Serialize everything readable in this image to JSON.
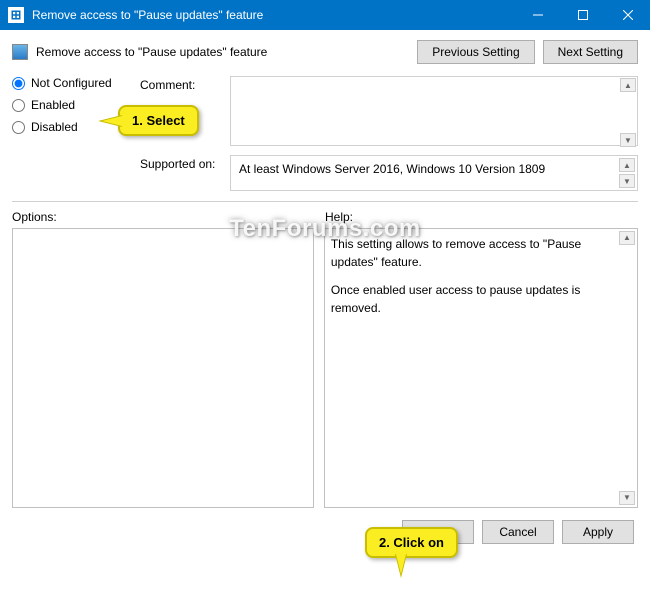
{
  "titlebar": {
    "title": "Remove access to \"Pause updates\" feature"
  },
  "header": {
    "title": "Remove access to \"Pause updates\" feature",
    "prev_button": "Previous Setting",
    "next_button": "Next Setting"
  },
  "radio": {
    "not_configured": "Not Configured",
    "enabled": "Enabled",
    "disabled": "Disabled"
  },
  "labels": {
    "comment": "Comment:",
    "supported": "Supported on:",
    "options": "Options:",
    "help": "Help:"
  },
  "supported_text": "At least Windows Server 2016, Windows 10 Version 1809",
  "help_text": {
    "line1": "This setting allows to remove access to \"Pause updates\" feature.",
    "line2": "Once enabled user access to pause updates is removed."
  },
  "buttons": {
    "ok": "OK",
    "cancel": "Cancel",
    "apply": "Apply"
  },
  "callouts": {
    "select": "1. Select",
    "click": "2. Click on"
  },
  "watermark": "TenForums.com"
}
